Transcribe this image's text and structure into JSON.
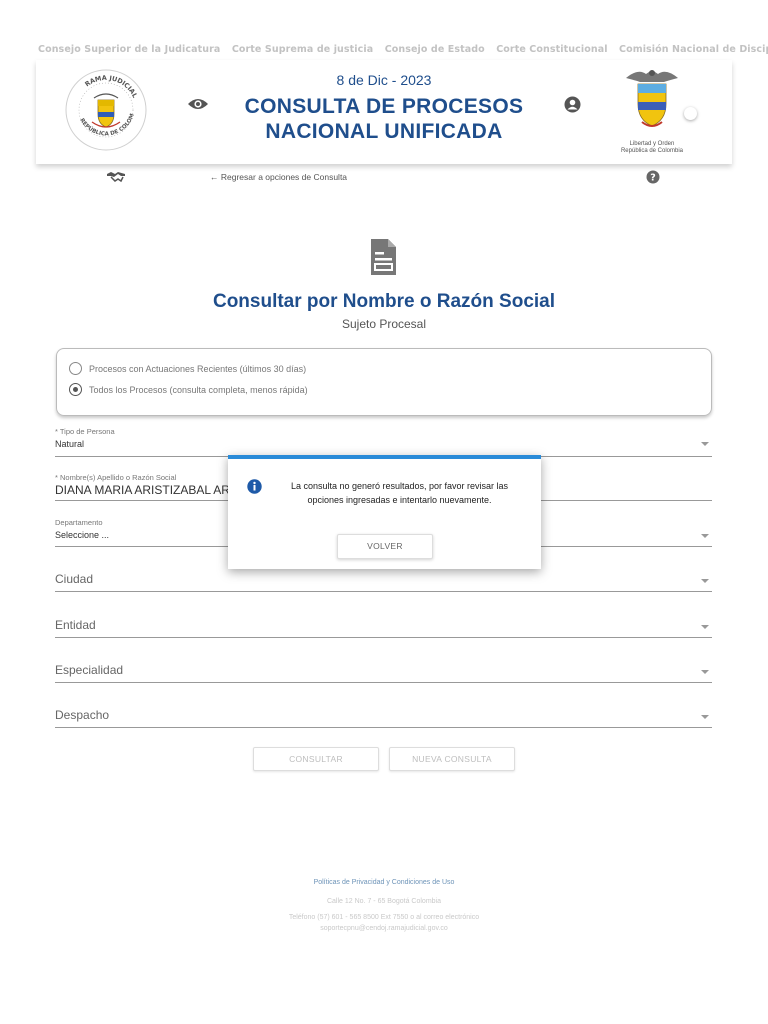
{
  "topnav": {
    "links": [
      "Consejo Superior de la Judicatura",
      "Corte Suprema de justicia",
      "Consejo de Estado",
      "Corte Constitucional",
      "Comisión Nacional de Discip"
    ]
  },
  "header": {
    "date": "8 de Dic - 2023",
    "title_line1": "CONSULTA DE PROCESOS",
    "title_line2": "NACIONAL UNIFICADA",
    "seal_text_top": "RAMA JUDICIAL",
    "seal_text_bottom": "REPÚBLICA DE COLOMBIA",
    "shield_caption_line1": "Libertad y Orden",
    "shield_caption_line2": "República de Colombia",
    "brand_color": "#1f4e8c"
  },
  "subbar": {
    "back_link": "Regresar a opciones de Consulta"
  },
  "page": {
    "title": "Consultar por Nombre o Razón Social",
    "subtitle": "Sujeto Procesal"
  },
  "search_options": {
    "option1": "Procesos con Actuaciones Recientes (últimos 30 días)",
    "option2": "Todos los Procesos (consulta completa, menos rápida)",
    "selected": "option2"
  },
  "form": {
    "tipo_label": "* Tipo de Persona",
    "tipo_value": "Natural",
    "nombre_label": "* Nombre(s) Apellido o Razón Social",
    "nombre_value": "DIANA MARIA ARISTIZABAL AR",
    "departamento_label": "Departamento",
    "departamento_value": "Seleccione ...",
    "ciudad": "Ciudad",
    "entidad": "Entidad",
    "especialidad": "Especialidad",
    "despacho": "Despacho"
  },
  "buttons": {
    "consultar": "CONSULTAR",
    "nueva": "NUEVA CONSULTA"
  },
  "footer": {
    "policy": "Políticas de Privacidad y Condiciones de Uso",
    "address": "Calle 12 No. 7 - 65 Bogotá Colombia",
    "phone": "Teléfono (57) 601 - 565 8500 Ext 7550 o al correo electrónico",
    "email": "soportecpnu@cendoj.ramajudicial.gov.co"
  },
  "dialog": {
    "message": "La consulta no generó resultados, por favor revisar las opciones ingresadas e intentarlo nuevamente.",
    "button": "VOLVER",
    "accent_color": "#2a8bd8"
  }
}
